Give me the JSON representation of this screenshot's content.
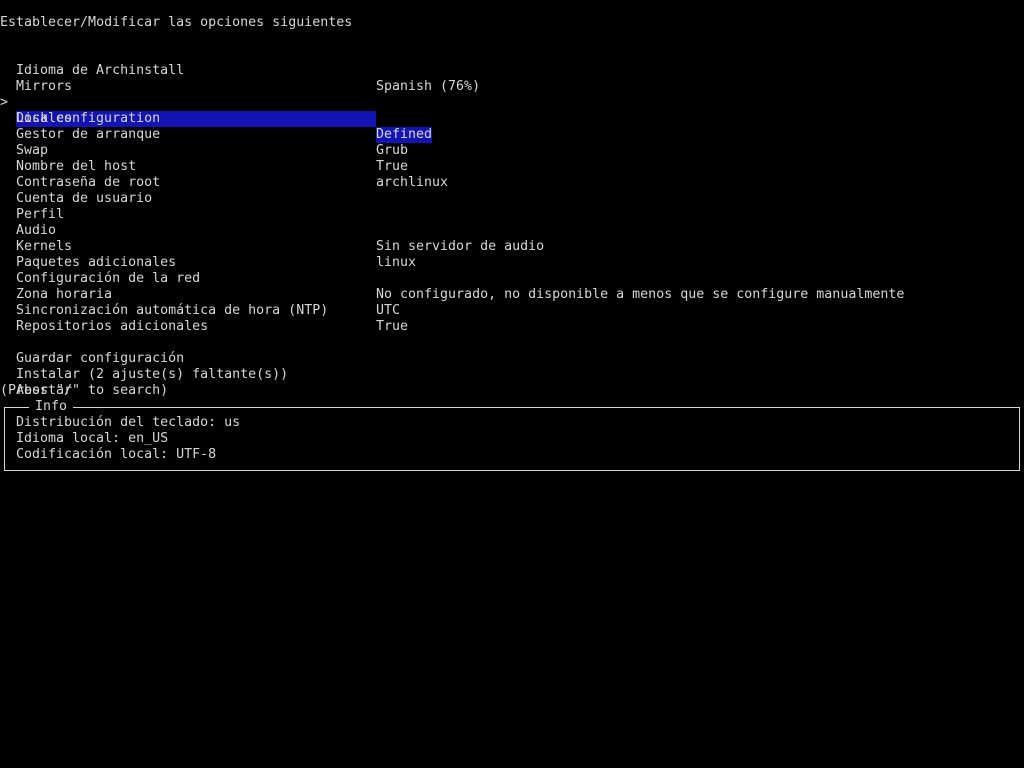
{
  "header": {
    "title": "Establecer/Modificar las opciones siguientes"
  },
  "menu": {
    "cursor": ">",
    "items": [
      {
        "label": "Idioma de Archinstall",
        "value": "Spanish (76%)"
      },
      {
        "label": "Mirrors",
        "value": ""
      },
      {
        "label": "Locales",
        "value": "Defined",
        "selected": true
      },
      {
        "label": "Disk configuration",
        "value": ""
      },
      {
        "label": "Gestor de arranque",
        "value": "Grub"
      },
      {
        "label": "Swap",
        "value": "True"
      },
      {
        "label": "Nombre del host",
        "value": "archlinux"
      },
      {
        "label": "Contraseña de root",
        "value": ""
      },
      {
        "label": "Cuenta de usuario",
        "value": ""
      },
      {
        "label": "Perfil",
        "value": ""
      },
      {
        "label": "Audio",
        "value": "Sin servidor de audio"
      },
      {
        "label": "Kernels",
        "value": "linux"
      },
      {
        "label": "Paquetes adicionales",
        "value": ""
      },
      {
        "label": "Configuración de la red",
        "value": "No configurado, no disponible a menos que se configure manualmente"
      },
      {
        "label": "Zona horaria",
        "value": "UTC"
      },
      {
        "label": "Sincronización automática de hora (NTP)",
        "value": "True"
      },
      {
        "label": "Repositorios adicionales",
        "value": ""
      }
    ],
    "actions": [
      {
        "label": "Guardar configuración"
      },
      {
        "label": "Instalar (2 ajuste(s) faltante(s))"
      },
      {
        "label": "Abortar"
      }
    ]
  },
  "footer": {
    "search_hint": "(Press \"/\" to search)"
  },
  "info": {
    "title": "Info",
    "lines": [
      "Distribución del teclado: us",
      "Idioma local: en_US",
      "Codificación local: UTF-8"
    ]
  },
  "colors": {
    "background": "#000000",
    "text": "#d6d6d6",
    "highlight": "#1414b4"
  }
}
